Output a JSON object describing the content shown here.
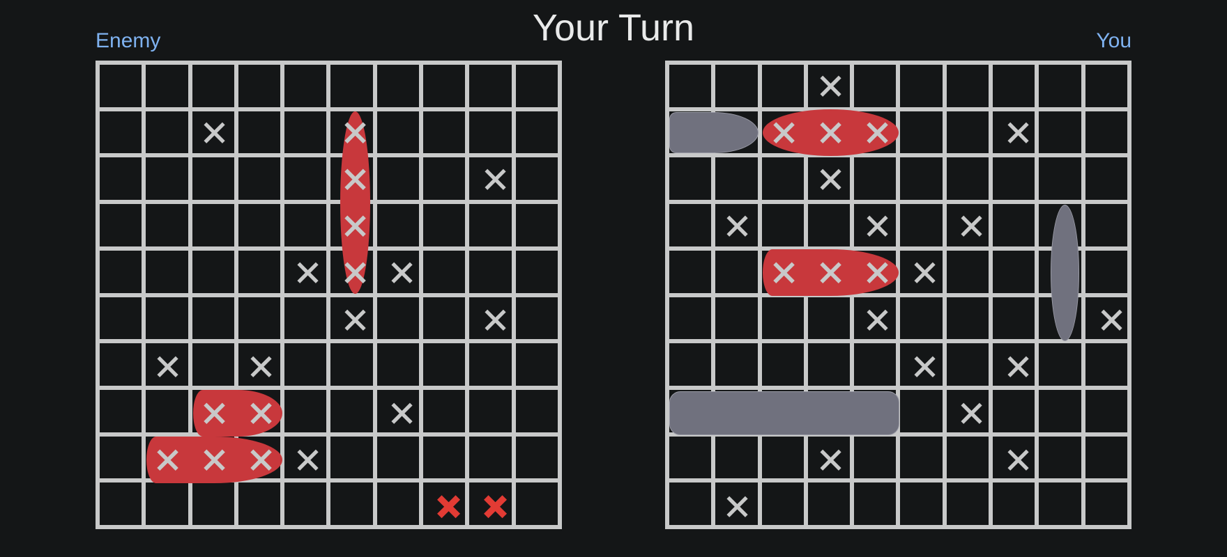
{
  "header": {
    "title": "Your Turn",
    "enemy_label": "Enemy",
    "you_label": "You"
  },
  "colors": {
    "background": "#141617",
    "grid_line": "#c8c9c9",
    "cell": "#141617",
    "label_blue": "#7fb2f0",
    "title_text": "#e9eaea",
    "sunk_ship_red": "#c8383c",
    "own_ship_gray": "#70717e",
    "miss_mark": "#c8c9c9",
    "fresh_hit_red": "#e23b34"
  },
  "boards": {
    "enemy": {
      "name": "Enemy",
      "rows": 10,
      "cols": 10,
      "marks": [
        {
          "row": 1,
          "col": 2,
          "type": "miss"
        },
        {
          "row": 1,
          "col": 5,
          "type": "hit"
        },
        {
          "row": 2,
          "col": 5,
          "type": "hit"
        },
        {
          "row": 2,
          "col": 8,
          "type": "miss"
        },
        {
          "row": 3,
          "col": 5,
          "type": "hit"
        },
        {
          "row": 4,
          "col": 4,
          "type": "miss"
        },
        {
          "row": 4,
          "col": 5,
          "type": "hit"
        },
        {
          "row": 4,
          "col": 6,
          "type": "miss"
        },
        {
          "row": 5,
          "col": 5,
          "type": "miss"
        },
        {
          "row": 5,
          "col": 8,
          "type": "miss"
        },
        {
          "row": 6,
          "col": 1,
          "type": "miss"
        },
        {
          "row": 6,
          "col": 3,
          "type": "miss"
        },
        {
          "row": 7,
          "col": 2,
          "type": "hit"
        },
        {
          "row": 7,
          "col": 3,
          "type": "hit"
        },
        {
          "row": 7,
          "col": 6,
          "type": "miss"
        },
        {
          "row": 8,
          "col": 1,
          "type": "hit"
        },
        {
          "row": 8,
          "col": 2,
          "type": "hit"
        },
        {
          "row": 8,
          "col": 3,
          "type": "hit"
        },
        {
          "row": 8,
          "col": 4,
          "type": "miss"
        },
        {
          "row": 9,
          "col": 7,
          "type": "freshhit"
        },
        {
          "row": 9,
          "col": 8,
          "type": "freshhit"
        }
      ],
      "ships": [
        {
          "row": 1,
          "col": 5,
          "length": 4,
          "orientation": "v",
          "state": "sunk",
          "shape": "ellipse"
        },
        {
          "row": 7,
          "col": 2,
          "length": 2,
          "orientation": "h",
          "state": "sunk",
          "shape": "bullet"
        },
        {
          "row": 8,
          "col": 1,
          "length": 3,
          "orientation": "h",
          "state": "sunk",
          "shape": "bullet"
        }
      ]
    },
    "you": {
      "name": "You",
      "rows": 10,
      "cols": 10,
      "marks": [
        {
          "row": 0,
          "col": 3,
          "type": "miss"
        },
        {
          "row": 1,
          "col": 2,
          "type": "hit"
        },
        {
          "row": 1,
          "col": 3,
          "type": "hit"
        },
        {
          "row": 1,
          "col": 4,
          "type": "hit"
        },
        {
          "row": 1,
          "col": 7,
          "type": "miss"
        },
        {
          "row": 2,
          "col": 3,
          "type": "miss"
        },
        {
          "row": 3,
          "col": 1,
          "type": "miss"
        },
        {
          "row": 3,
          "col": 4,
          "type": "miss"
        },
        {
          "row": 3,
          "col": 6,
          "type": "miss"
        },
        {
          "row": 4,
          "col": 2,
          "type": "hit"
        },
        {
          "row": 4,
          "col": 3,
          "type": "hit"
        },
        {
          "row": 4,
          "col": 4,
          "type": "hit"
        },
        {
          "row": 4,
          "col": 5,
          "type": "miss"
        },
        {
          "row": 5,
          "col": 4,
          "type": "miss"
        },
        {
          "row": 5,
          "col": 9,
          "type": "miss"
        },
        {
          "row": 6,
          "col": 5,
          "type": "miss"
        },
        {
          "row": 6,
          "col": 7,
          "type": "miss"
        },
        {
          "row": 7,
          "col": 6,
          "type": "miss"
        },
        {
          "row": 8,
          "col": 3,
          "type": "miss"
        },
        {
          "row": 8,
          "col": 7,
          "type": "miss"
        },
        {
          "row": 9,
          "col": 1,
          "type": "miss"
        }
      ],
      "ships": [
        {
          "row": 1,
          "col": 0,
          "length": 2,
          "orientation": "h",
          "state": "alive",
          "shape": "bullet"
        },
        {
          "row": 1,
          "col": 2,
          "length": 3,
          "orientation": "h",
          "state": "sunk",
          "shape": "ellipse"
        },
        {
          "row": 3,
          "col": 8,
          "length": 3,
          "orientation": "v",
          "state": "alive",
          "shape": "ellipse"
        },
        {
          "row": 4,
          "col": 2,
          "length": 3,
          "orientation": "h",
          "state": "sunk",
          "shape": "bullet"
        },
        {
          "row": 7,
          "col": 0,
          "length": 5,
          "orientation": "h",
          "state": "alive",
          "shape": "rounded"
        }
      ]
    }
  }
}
